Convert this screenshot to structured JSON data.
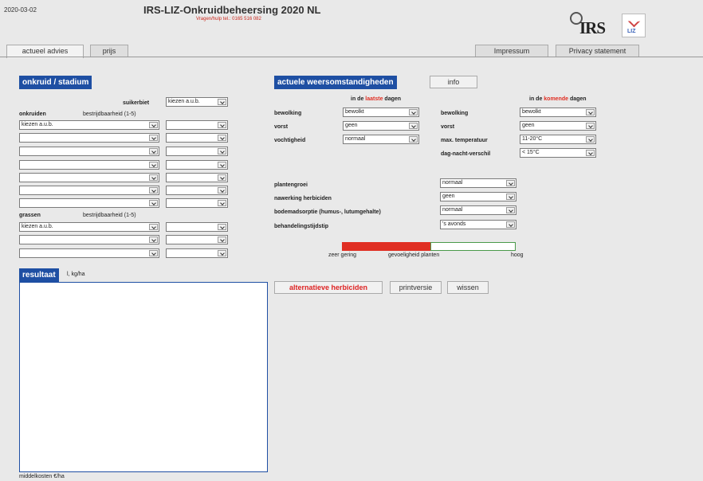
{
  "header": {
    "date": "2020-03-02",
    "title": "IRS-LIZ-Onkruidbeheersing 2020 NL",
    "help": "Vragen/hulp tel.: 0165 516 082",
    "logo_irs": "IRS",
    "logo_liz": "LIZ"
  },
  "tabs": {
    "advies": "actueel advies",
    "prijs": "prijs",
    "impressum": "Impressum",
    "privacy": "Privacy statement"
  },
  "onkruid": {
    "heading": "onkruid / stadium",
    "suikerbiet_label": "suikerbiet",
    "suikerbiet_value": "kiezen a.u.b.",
    "onkruiden_label": "onkruiden",
    "bestrijdbaarheid_label": "bestrijdbaarheid (1-5)",
    "onkruid_first_value": "kiezen a.u.b.",
    "grassen_label": "grassen",
    "grassen_bestrijdbaarheid_label": "bestrijdbaarheid (1-5)",
    "grassen_first_value": "kiezen a.u.b."
  },
  "weer": {
    "heading": "actuele weersomstandigheden",
    "info_button": "info",
    "past_header_prefix": "in de ",
    "past_header_word": "laatste",
    "past_header_suffix": " dagen",
    "future_header_prefix": "in de ",
    "future_header_word": "komende",
    "future_header_suffix": " dagen",
    "past": {
      "bewolking_label": "bewolking",
      "bewolking_value": "bewolkt",
      "vorst_label": "vorst",
      "vorst_value": "geen",
      "vochtigheid_label": "vochtigheid",
      "vochtigheid_value": "normaal"
    },
    "future": {
      "bewolking_label": "bewolking",
      "bewolking_value": "bewolkt",
      "vorst_label": "vorst",
      "vorst_value": "geen",
      "maxtemp_label": "max. temperatuur",
      "maxtemp_value": "11-20°C",
      "dagnacht_label": "dag-nacht-verschil",
      "dagnacht_value": "< 15°C"
    }
  },
  "overig": {
    "plantengroei_label": "plantengroei",
    "plantengroei_value": "normaal",
    "nawerking_label": "nawerking herbiciden",
    "nawerking_value": "geen",
    "bodem_label": "bodemadsorptie (humus-, lutumgehalte)",
    "bodem_value": "normaal",
    "tijdstip_label": "behandelingstijdstip",
    "tijdstip_value": "'s avonds"
  },
  "gevoeligheid": {
    "low": "zeer gering",
    "mid": "gevoeligheid planten",
    "high": "hoog",
    "level": 0.51,
    "colors": {
      "filled": "#e02e22",
      "empty_border": "#4a9a4a"
    }
  },
  "resultaat": {
    "heading": "resultaat",
    "unit": "l, kg/ha",
    "footer": "middelkosten €/ha"
  },
  "actions": {
    "alternatieve": "alternatieve herbiciden",
    "printversie": "printversie",
    "wissen": "wissen"
  },
  "colors": {
    "section_blue": "#1e4fa3",
    "accent_red": "#e02e22"
  }
}
